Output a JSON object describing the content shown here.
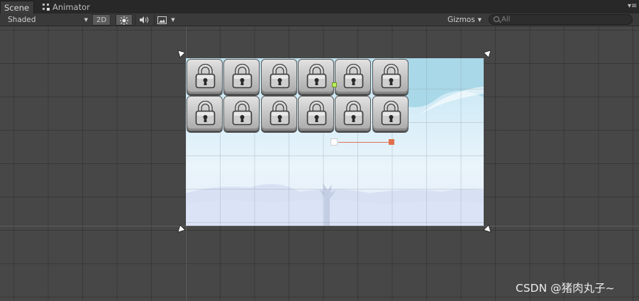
{
  "tabs": [
    {
      "label": "Scene",
      "active": true
    },
    {
      "label": "Animator",
      "active": false
    }
  ],
  "tab_menu_icon": "panel-menu-icon",
  "toolbar": {
    "draw_mode": "Shaded",
    "mode_2d": "2D",
    "lighting_icon": "sun-icon",
    "audio_icon": "speaker-icon",
    "effects_icon": "image-icon",
    "gizmos": "Gizmos",
    "search_placeholder": "All"
  },
  "scene": {
    "level_grid": {
      "rows": 2,
      "columns": 6,
      "cell_icon": "padlock-icon",
      "cells_locked": [
        [
          true,
          true,
          true,
          true,
          true,
          true
        ],
        [
          true,
          true,
          true,
          true,
          true,
          true
        ]
      ]
    },
    "background": "sky-with-hills",
    "pivot_color": "#b7f25a",
    "gizmo_line_color": "#e07060"
  },
  "watermark": "CSDN @猪肉丸子~",
  "colors": {
    "editor_bg": "#474747",
    "toolbar_bg": "#3a3a3a",
    "tabbar_bg": "#282828"
  }
}
